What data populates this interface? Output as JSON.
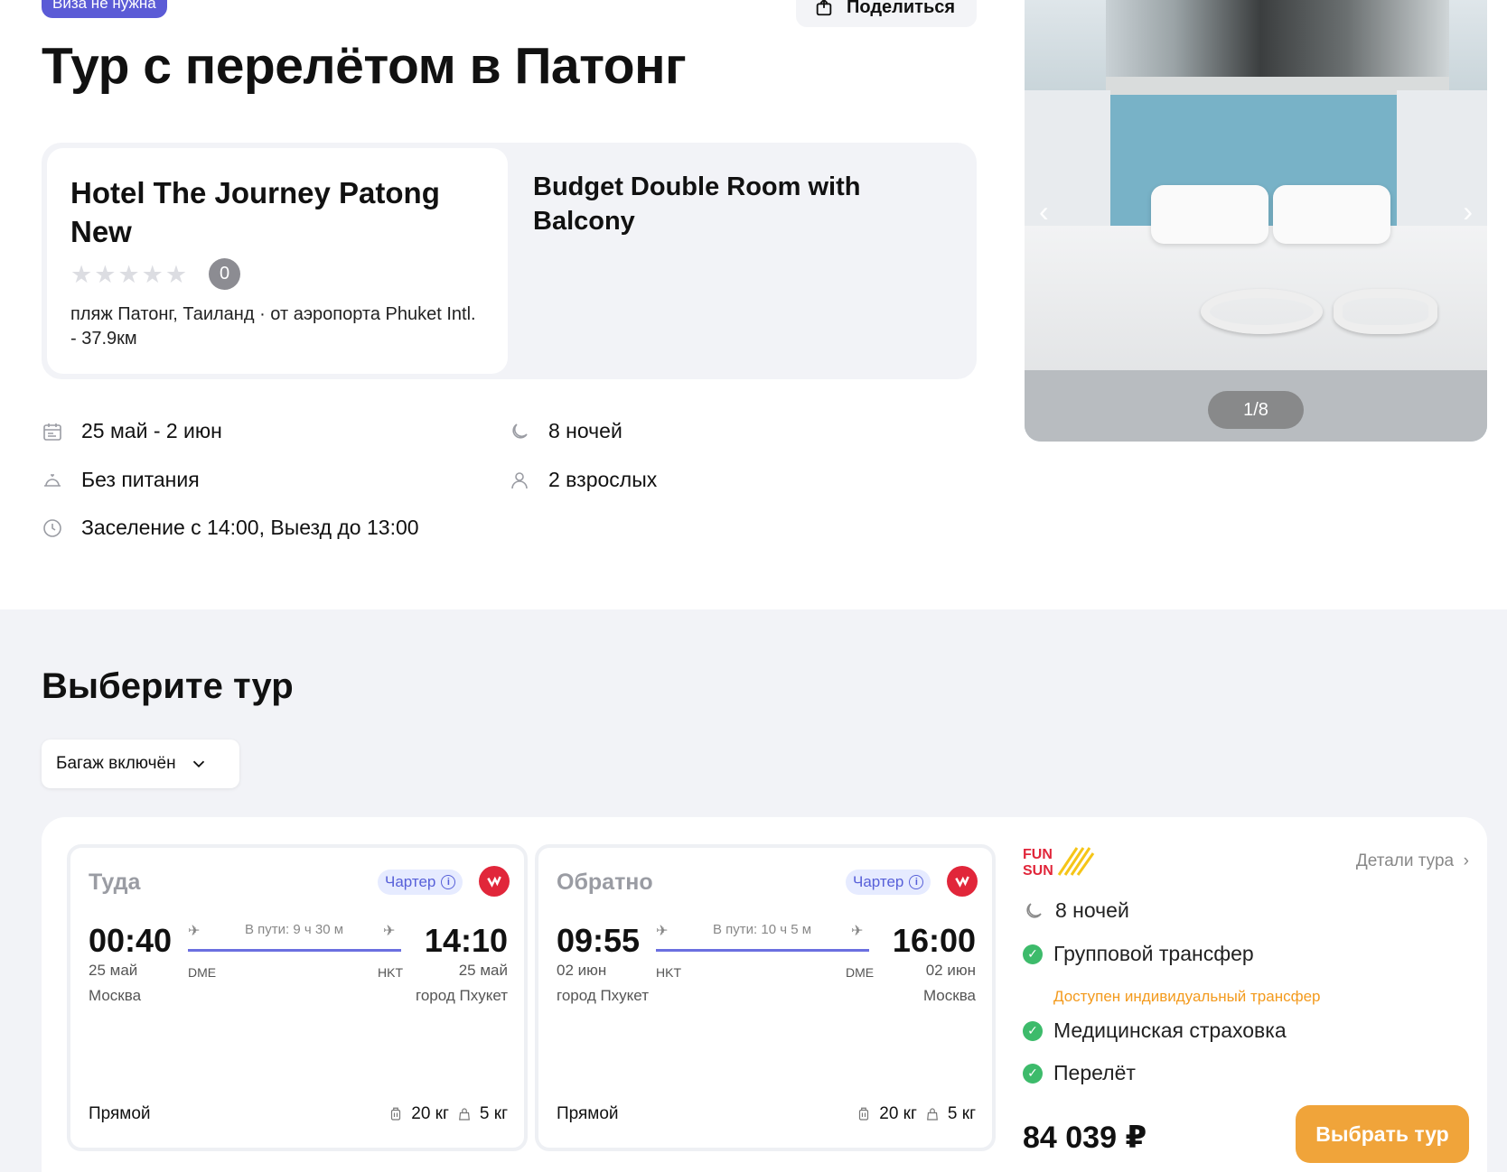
{
  "header": {
    "visa_badge": "Виза не нужна",
    "share_label": "Поделиться",
    "title": "Тур с перелётом в Патонг"
  },
  "hotel": {
    "name": "Hotel The Journey Patong New",
    "stars": 0,
    "rating": "0",
    "location": "пляж Патонг, Таиланд",
    "airport_distance": "от аэропорта Phuket Intl. - 37.9км",
    "room": "Budget Double Room with Balcony"
  },
  "gallery": {
    "counter": "1/8",
    "prev_icon": "chevron-left-icon",
    "next_icon": "chevron-right-icon"
  },
  "info": {
    "dates": "25 май - 2 июн",
    "nights": "8 ночей",
    "meals": "Без питания",
    "guests": "2 взрослых",
    "checkin": "Заселение с 14:00, Выезд до 13:00"
  },
  "tours": {
    "section_title": "Выберите тур",
    "filter_label": "Багаж включён",
    "outbound": {
      "label": "Туда",
      "charter": "Чартер",
      "dep_time": "00:40",
      "dep_date": "25 май",
      "dep_city": "Москва",
      "dep_code": "DME",
      "duration": "В пути: 9 ч 30 м",
      "arr_time": "14:10",
      "arr_date": "25 май",
      "arr_city": "город Пхукет",
      "arr_code": "HKT",
      "type": "Прямой",
      "luggage": "20 кг",
      "hand": "5 кг"
    },
    "return": {
      "label": "Обратно",
      "charter": "Чартер",
      "dep_time": "09:55",
      "dep_date": "02 июн",
      "dep_city": "город Пхукет",
      "dep_code": "HKT",
      "duration": "В пути: 10 ч 5 м",
      "arr_time": "16:00",
      "arr_date": "02 июн",
      "arr_city": "Москва",
      "arr_code": "DME",
      "type": "Прямой",
      "luggage": "20 кг",
      "hand": "5 кг"
    },
    "summary": {
      "operator_logo_text": "FUN&SUN",
      "details_link": "Детали тура",
      "nights": "8 ночей",
      "transfer": "Групповой трансфер",
      "transfer_note": "Доступен индивидуальный трансфер",
      "insurance": "Медицинская страховка",
      "flight": "Перелёт",
      "price": "84 039 ₽",
      "choose_button": "Выбрать тур"
    }
  },
  "colors": {
    "accent": "#5b5bd6",
    "route": "#6b6fe0",
    "orange": "#f0a43a",
    "green": "#3dbb6b",
    "airline_red": "#e1263a"
  }
}
